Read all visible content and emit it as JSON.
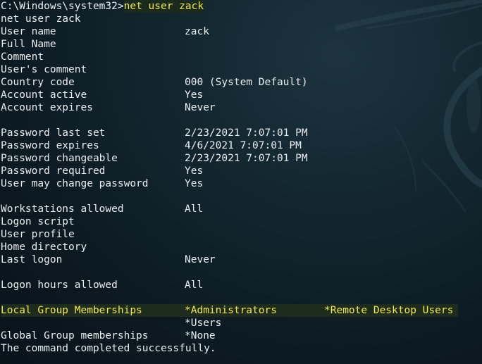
{
  "window": {
    "prompt_path": "C:\\Windows\\system32>",
    "prompt_command": "net user zack",
    "echo_command": "net user zack"
  },
  "colors": {
    "background": "#0d1d26",
    "text": "#eaeef0",
    "highlight_text": "#f3e94e",
    "highlight_bg": "#1e2c1e"
  },
  "account": {
    "user_name": {
      "label": "User name",
      "value": "zack"
    },
    "full_name": {
      "label": "Full Name",
      "value": ""
    },
    "comment": {
      "label": "Comment",
      "value": ""
    },
    "users_comment": {
      "label": "User's comment",
      "value": ""
    },
    "country_code": {
      "label": "Country code",
      "value": "000 (System Default)"
    },
    "account_active": {
      "label": "Account active",
      "value": "Yes"
    },
    "account_expires": {
      "label": "Account expires",
      "value": "Never"
    }
  },
  "password": {
    "last_set": {
      "label": "Password last set",
      "value": "2/23/2021 7:07:01 PM"
    },
    "expires": {
      "label": "Password expires",
      "value": "4/6/2021 7:07:01 PM"
    },
    "changeable": {
      "label": "Password changeable",
      "value": "2/23/2021 7:07:01 PM"
    },
    "required": {
      "label": "Password required",
      "value": "Yes"
    },
    "user_may_change": {
      "label": "User may change password",
      "value": "Yes"
    }
  },
  "logon": {
    "workstations": {
      "label": "Workstations allowed",
      "value": "All"
    },
    "script": {
      "label": "Logon script",
      "value": ""
    },
    "profile": {
      "label": "User profile",
      "value": ""
    },
    "home_dir": {
      "label": "Home directory",
      "value": ""
    },
    "last_logon": {
      "label": "Last logon",
      "value": "Never"
    }
  },
  "hours": {
    "label": "Logon hours allowed",
    "value": "All"
  },
  "groups": {
    "local_label": "Local Group Memberships",
    "local": [
      "*Administrators",
      "*Remote Desktop Users",
      "*Users"
    ],
    "global_label": "Global Group memberships",
    "global": [
      "*None"
    ]
  },
  "status": "The command completed successfully."
}
